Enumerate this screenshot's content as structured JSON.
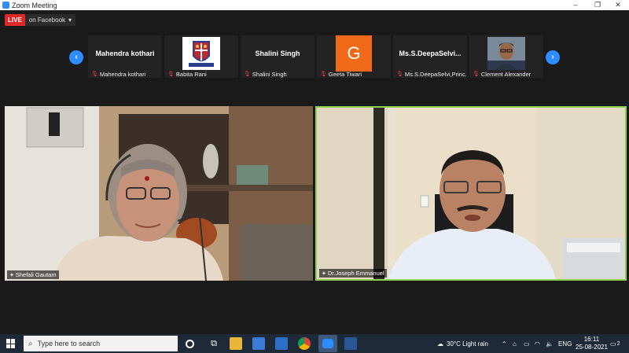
{
  "window": {
    "title": "Zoom Meeting"
  },
  "live": {
    "badge": "LIVE",
    "platform": "on Facebook"
  },
  "participants": [
    {
      "display": "Mahendra kothari",
      "caption": "Mahendra kothari"
    },
    {
      "display": "",
      "caption": "Babita Rani"
    },
    {
      "display": "Shalini Singh",
      "caption": "Shalini Singh"
    },
    {
      "display": "G",
      "caption": "Geeta Tiwari"
    },
    {
      "display": "Ms.S.DeepaSelvi...",
      "caption": "Ms.S.DeepaSelvi,Princ..."
    },
    {
      "display": "",
      "caption": "Clement Alexander"
    }
  ],
  "videos": [
    {
      "name": "Shefali Gautam"
    },
    {
      "name": "Dr.Joseph Emmanuel"
    }
  ],
  "taskbar": {
    "search_placeholder": "Type here to search",
    "weather": "30°C  Light rain",
    "lang": "ENG",
    "time": "16:11",
    "date": "25-08-2021",
    "notifications": "2"
  },
  "colors": {
    "accent": "#2d8cff",
    "live": "#e02828",
    "active_speaker": "#8fd14f",
    "avatar_g": "#f06a1a"
  }
}
